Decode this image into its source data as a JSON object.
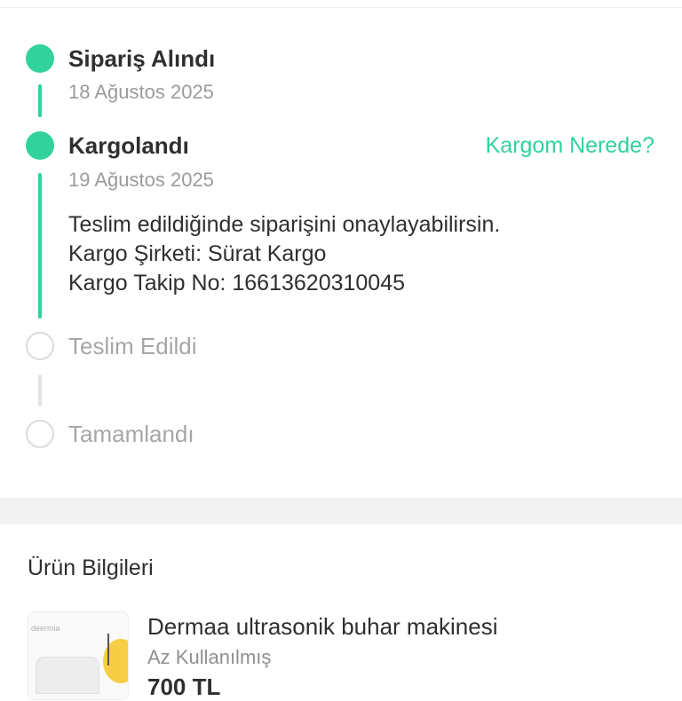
{
  "timeline": {
    "steps": [
      {
        "title": "Sipariş Alındı",
        "date": "18 Ağustos 2025",
        "status": "done"
      },
      {
        "title": "Kargolandı",
        "date": "19 Ağustos 2025",
        "status": "done"
      },
      {
        "title": "Teslim Edildi",
        "status": "pending"
      },
      {
        "title": "Tamamlandı",
        "status": "pending"
      }
    ],
    "track_link": "Kargom Nerede?",
    "shipping_details": [
      "Teslim edildiğinde siparişini onaylayabilirsin.",
      "Kargo Şirketi: Sürat Kargo",
      "Kargo Takip No: 16613620310045"
    ]
  },
  "product_section": {
    "title": "Ürün Bilgileri",
    "product": {
      "name": "Dermaa ultrasonik buhar makinesi",
      "condition": "Az Kullanılmış",
      "price": "700 TL",
      "thumb_brand": "deermia"
    }
  },
  "colors": {
    "accent": "#31d29c",
    "pending": "#dcdcdc",
    "text": "#2f2f2f",
    "muted": "#9b9b9b",
    "section_bg": "#f2f2f2"
  }
}
